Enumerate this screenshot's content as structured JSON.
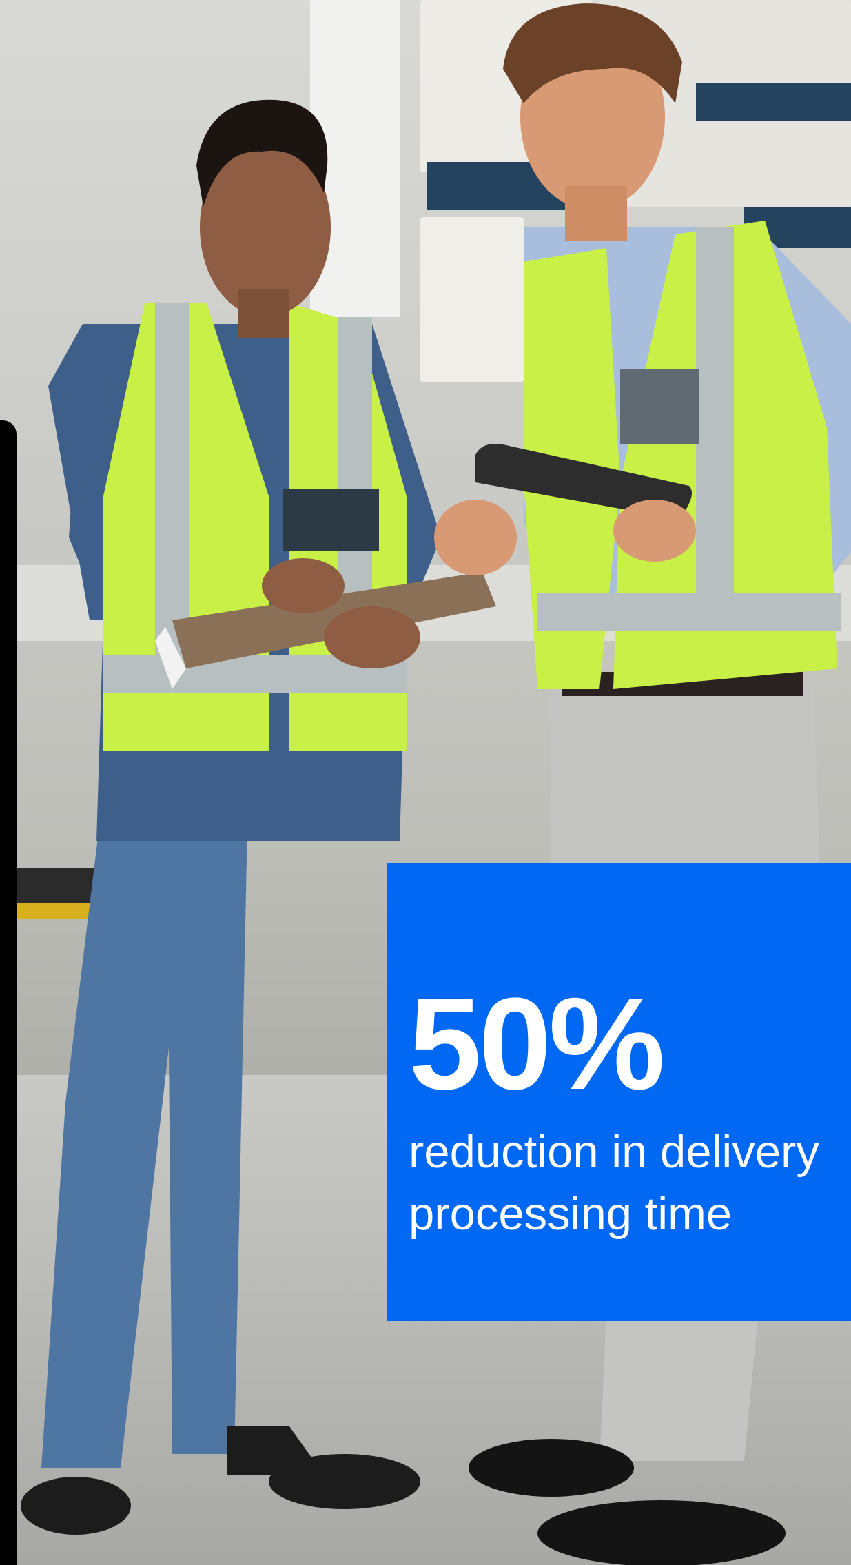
{
  "photo": {
    "subject": "warehouse-workers-photo"
  },
  "stat": {
    "value": "50%",
    "caption_line1": "reduction in delivery",
    "caption_line2": "processing time"
  },
  "colors": {
    "accent": "#0068f2",
    "accent_text": "#ffffff",
    "vest": "#c9f046",
    "shirt_blue": "#3e5f8a",
    "jeans": "#4a6f99"
  }
}
